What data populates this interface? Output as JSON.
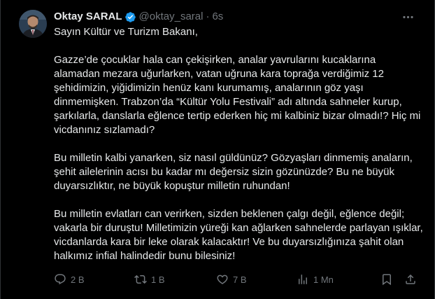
{
  "tweet": {
    "author_name": "Oktay SARAL",
    "handle": "@oktay_saral",
    "separator": "·",
    "time": "6s",
    "paragraphs": [
      "Sayın Kültür ve Turizm Bakanı,",
      "Gazze’de çocuklar hala can çekişirken, analar yavrularını kucaklarına alamadan mezara uğurlarken, vatan uğruna kara toprağa verdiğimiz 12 şehidimizin, yiğidimizin henüz kanı kurumamış, analarının göz yaşı dinmemişken. Trabzon’da “Kültür Yolu Festivali” adı altında sahneler kurup, şarkılarla, danslarla eğlence tertip ederken hiç mi kalbiniz bizar olmadı!? Hiç mi vicdanınız sızlamadı?",
      "Bu milletin kalbi yanarken, siz nasıl güldünüz? Gözyaşları dinmemiş anaların, şehit ailelerinin acısı bu kadar mı değersiz sizin gözünüzde? Bu ne büyük duyarsızlıktır, ne büyük kopuştur milletin ruhundan!",
      "Bu milletin evlatları can verirken, sizden beklenen çalgı değil, eğlence değil; vakarla bir duruştu! Milletimizin yüreği kan ağlarken sahnelerde parlayan ışıklar, vicdanlarda kara bir leke olarak kalacaktır! Ve bu duyarsızlığınıza şahit olan halkımız infial halindedir bunu bilesiniz!"
    ]
  },
  "actions": {
    "replies": "2 B",
    "reposts": "1 B",
    "likes": "7 B",
    "views": "1 Mn"
  },
  "icons": {
    "verified": "verified-badge-icon",
    "more": "more-options-icon",
    "reply": "reply-icon",
    "repost": "repost-icon",
    "like": "like-icon",
    "views": "views-icon",
    "bookmark": "bookmark-icon",
    "share": "share-icon"
  },
  "colors": {
    "background": "#000000",
    "text": "#e7e9ea",
    "muted": "#71767b",
    "verified": "#1d9bf0"
  }
}
